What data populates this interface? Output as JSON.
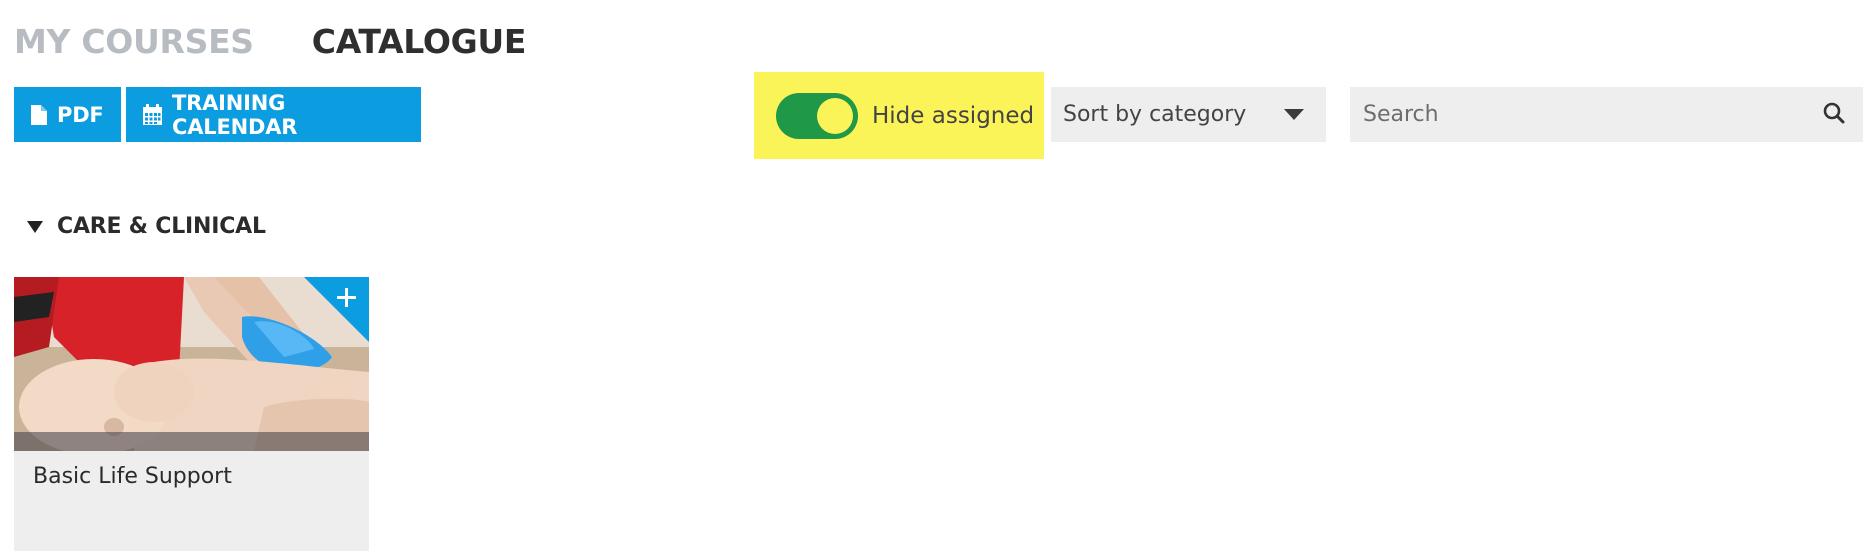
{
  "tabs": {
    "my_courses": "MY COURSES",
    "catalogue": "CATALOGUE"
  },
  "toolbar": {
    "pdf_label": "PDF",
    "calendar_label": "TRAINING CALENDAR",
    "hide_assigned_label": "Hide assigned",
    "hide_assigned_on": true,
    "sort_value": "Sort by category",
    "search_placeholder": "Search"
  },
  "category": {
    "name": "CARE & CLINICAL",
    "expanded": true
  },
  "courses": [
    {
      "title": "Basic Life Support"
    }
  ],
  "colors": {
    "accent_blue": "#0b9de0",
    "toggle_green": "#1f9848",
    "highlight_yellow": "#fbf458"
  }
}
